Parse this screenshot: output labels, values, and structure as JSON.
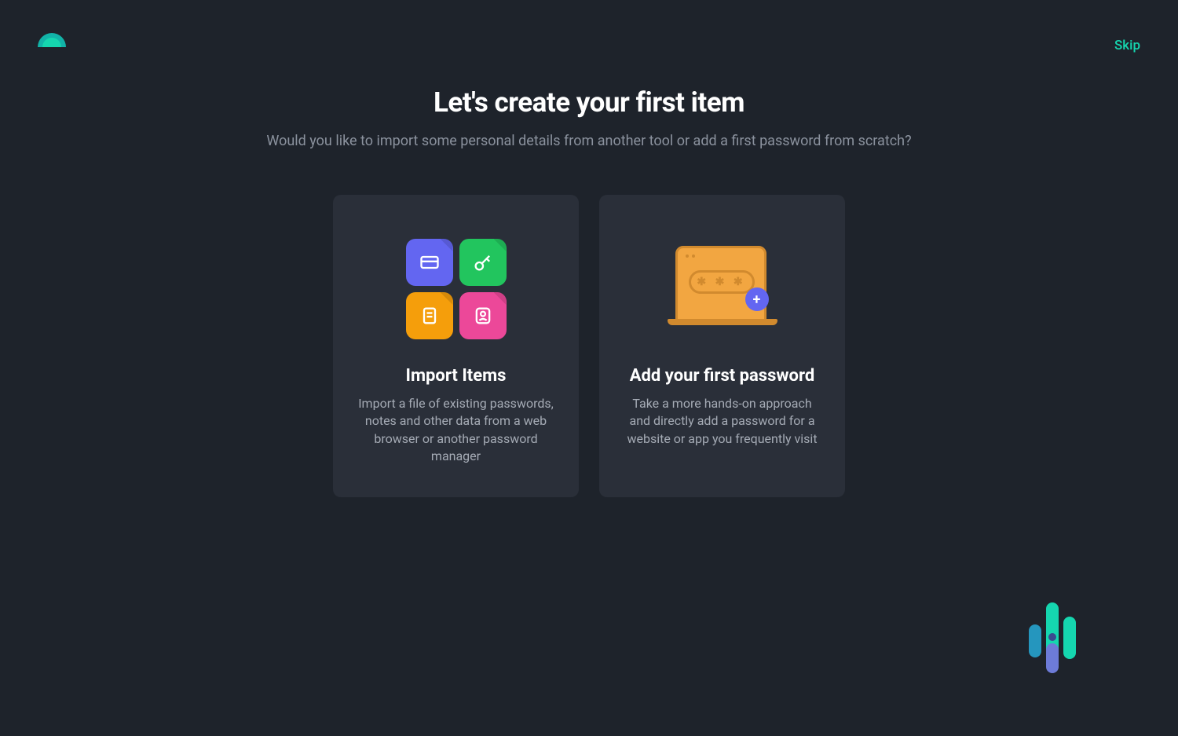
{
  "header": {
    "skip_label": "Skip"
  },
  "page": {
    "title": "Let's create your first item",
    "subtitle": "Would you like to import some personal details from another tool or add a first password from scratch?"
  },
  "cards": {
    "import": {
      "title": "Import Items",
      "description": "Import a file of existing passwords, notes and other data from a web browser or another password manager"
    },
    "add": {
      "title": "Add your first password",
      "description": "Take a more hands-on approach and directly add a password for a website or app you frequently visit"
    }
  }
}
